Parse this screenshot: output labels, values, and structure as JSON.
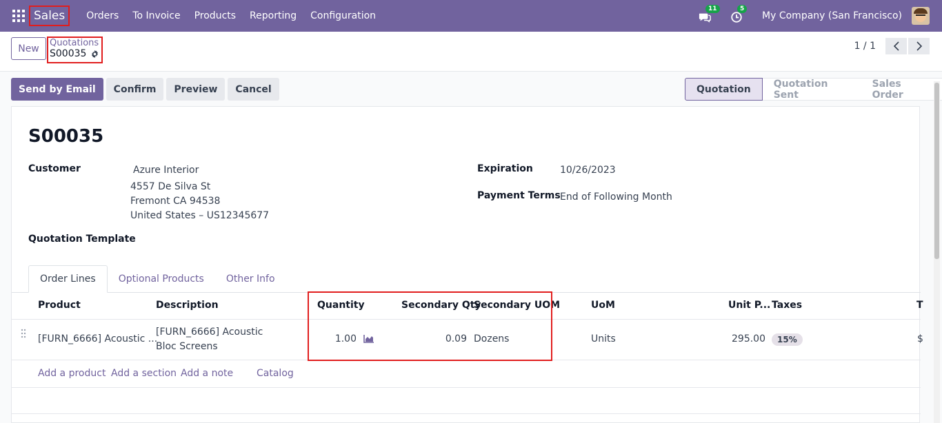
{
  "navbar": {
    "brand": "Sales",
    "menu": [
      "Orders",
      "To Invoice",
      "Products",
      "Reporting",
      "Configuration"
    ],
    "messages_count": "11",
    "activities_count": "5",
    "company": "My Company (San Francisco)",
    "accent_color": "#71639e"
  },
  "control_panel": {
    "new_label": "New",
    "breadcrumb_parent": "Quotations",
    "breadcrumb_current": "S00035",
    "pager_value": "1 / 1"
  },
  "actions": {
    "send_by_email": "Send by Email",
    "confirm": "Confirm",
    "preview": "Preview",
    "cancel": "Cancel"
  },
  "status": {
    "stages": [
      "Quotation",
      "Quotation Sent",
      "Sales Order"
    ],
    "active": "Quotation"
  },
  "form": {
    "name": "S00035",
    "customer_label": "Customer",
    "customer_name": "Azure Interior",
    "address_line1": "4557 De Silva St",
    "address_line2": "Fremont CA 94538",
    "address_line3": "United States – US12345677",
    "template_label": "Quotation Template",
    "expiration_label": "Expiration",
    "expiration_value": "10/26/2023",
    "payment_terms_label": "Payment Terms",
    "payment_terms_value": "End of Following Month"
  },
  "tabs": [
    "Order Lines",
    "Optional Products",
    "Other Info"
  ],
  "order_lines": {
    "columns": [
      "Product",
      "Description",
      "Quantity",
      "Secondary Qty",
      "Secondary UOM",
      "UoM",
      "Unit P...",
      "Taxes",
      "T"
    ],
    "rows": [
      {
        "product": "[FURN_6666] Acoustic ...",
        "description_line1": "[FURN_6666] Acoustic",
        "description_line2": "Bloc Screens",
        "quantity": "1.00",
        "secondary_qty": "0.09",
        "secondary_uom": "Dozens",
        "uom": "Units",
        "unit_price": "295.00",
        "taxes": "15%",
        "total": "$"
      }
    ],
    "add_product": "Add a product",
    "add_section": "Add a section",
    "add_note": "Add a note",
    "catalog": "Catalog"
  }
}
